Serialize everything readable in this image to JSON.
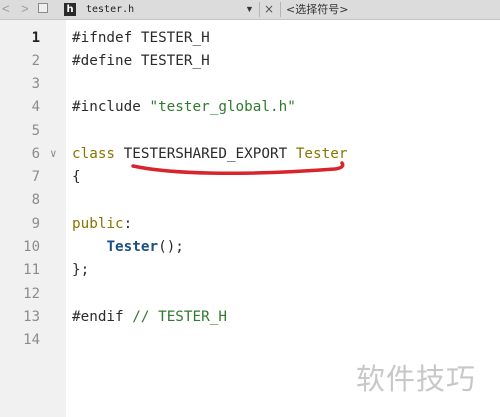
{
  "toolbar": {
    "back_icon": "chevron-left-icon",
    "forward_icon": "chevron-right-icon",
    "file_badge": "h",
    "file_name": "tester.h",
    "dropdown_glyph": "▼",
    "close_glyph": "×",
    "symbol_select": "<选择符号>"
  },
  "gutter": {
    "line_numbers": [
      "1",
      "2",
      "3",
      "4",
      "5",
      "6",
      "7",
      "8",
      "9",
      "10",
      "11",
      "12",
      "13",
      "14"
    ],
    "fold_glyph": "∨"
  },
  "code": {
    "l1": "#ifndef TESTER_H",
    "l2": "#define TESTER_H",
    "l4_a": "#include ",
    "l4_b": "\"tester_global.h\"",
    "l6_a": "class",
    "l6_b": " TESTERSHARED_EXPORT ",
    "l6_c": "Tester",
    "l7": "{",
    "l9_a": "public",
    "l9_b": ":",
    "l10_a": "    ",
    "l10_b": "Tester",
    "l10_c": "();",
    "l11": "};",
    "l13_a": "#endif ",
    "l13_b": "// TESTER_H"
  },
  "annotation": {
    "color": "#d9232d"
  },
  "watermark": "软件技巧",
  "colors": {
    "keyword": "#8a7500",
    "string": "#2f7a2f",
    "function": "#1b4f80"
  }
}
